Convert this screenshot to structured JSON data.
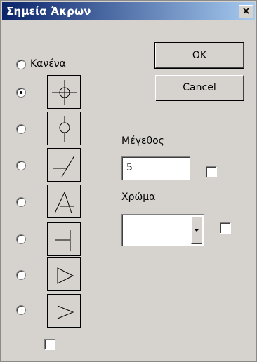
{
  "window": {
    "title": "Σημεία Άκρων",
    "close_label": "×"
  },
  "buttons": {
    "ok": "OK",
    "cancel": "Cancel"
  },
  "radios": {
    "none_label": "Κανένα"
  },
  "size": {
    "label": "Μέγεθος",
    "value": "5"
  },
  "color": {
    "label": "Χρώμα",
    "value": ""
  },
  "markers": [
    {
      "icon": "circle-cross-icon"
    },
    {
      "icon": "circle-on-line-icon"
    },
    {
      "icon": "slash-right-icon"
    },
    {
      "icon": "slash-left-icon"
    },
    {
      "icon": "t-bar-icon"
    },
    {
      "icon": "triangle-arrow-icon"
    },
    {
      "icon": "open-arrow-icon"
    }
  ]
}
